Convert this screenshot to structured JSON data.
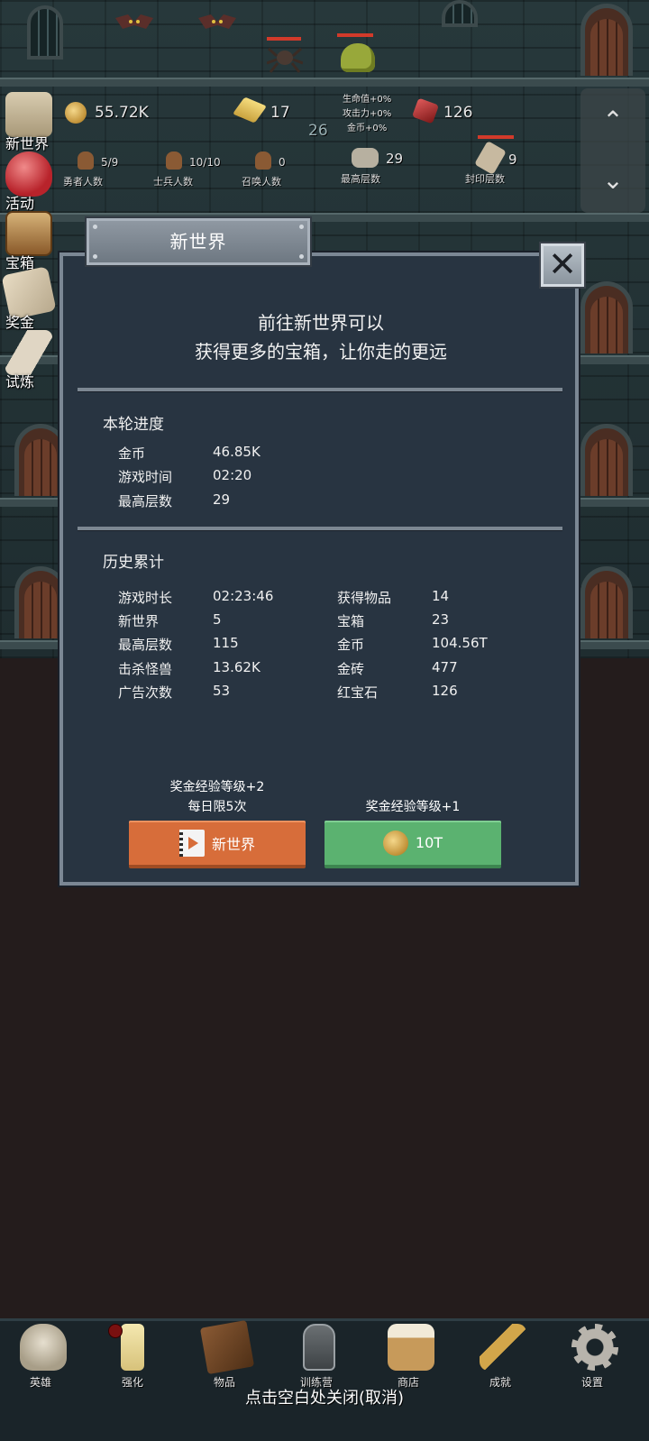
{
  "top": {
    "gold": "55.72K",
    "gold_bars": "17",
    "level_number": "26",
    "bonus_lines": [
      "生命值+0%",
      "攻击力+0%",
      "金币+0%"
    ],
    "rubies": "126",
    "heroes_value": "5/9",
    "heroes_label": "勇者人数",
    "soldiers_value": "10/10",
    "soldiers_label": "士兵人数",
    "summons_value": "0",
    "summons_label": "召唤人数",
    "max_floor_value": "29",
    "max_floor_label": "最高层数",
    "sealed_floor_value": "9",
    "sealed_floor_label": "封印层数"
  },
  "side_menu": [
    {
      "label": "新世界",
      "icon": "map-icon"
    },
    {
      "label": "活动",
      "icon": "heart-icon"
    },
    {
      "label": "宝箱",
      "icon": "chest-icon"
    },
    {
      "label": "奖金",
      "icon": "envelope-icon"
    },
    {
      "label": "试炼",
      "icon": "feather-icon"
    }
  ],
  "scroll": {
    "up": "⌃",
    "down": "⌄"
  },
  "dialog": {
    "title": "新世界",
    "close": "✕",
    "intro_line1": "前往新世界可以",
    "intro_line2": "获得更多的宝箱，让你走的更远",
    "current_title": "本轮进度",
    "current_rows": [
      {
        "label": "金币",
        "value": "46.85K"
      },
      {
        "label": "游戏时间",
        "value": "02:20"
      },
      {
        "label": "最高层数",
        "value": "29"
      }
    ],
    "history_title": "历史累计",
    "history_left": [
      {
        "label": "游戏时长",
        "value": "02:23:46"
      },
      {
        "label": "新世界",
        "value": "5"
      },
      {
        "label": "最高层数",
        "value": "115"
      },
      {
        "label": "击杀怪兽",
        "value": "13.62K"
      },
      {
        "label": "广告次数",
        "value": "53"
      }
    ],
    "history_right": [
      {
        "label": "获得物品",
        "value": "14"
      },
      {
        "label": "宝箱",
        "value": "23"
      },
      {
        "label": "金币",
        "value": "104.56T"
      },
      {
        "label": "金砖",
        "value": "477"
      },
      {
        "label": "红宝石",
        "value": "126"
      }
    ],
    "ad_caption_line1": "奖金经验等级+2",
    "ad_caption_line2": "每日限5次",
    "ad_button_label": "新世界",
    "coin_caption": "奖金经验等级+1",
    "coin_button_label": "10T"
  },
  "bottom_nav": [
    {
      "label": "英雄",
      "icon": "skull-icon"
    },
    {
      "label": "强化",
      "icon": "candle-icon"
    },
    {
      "label": "物品",
      "icon": "book-icon"
    },
    {
      "label": "训练营",
      "icon": "lantern-icon"
    },
    {
      "label": "商店",
      "icon": "mug-icon"
    },
    {
      "label": "成就",
      "icon": "key-icon"
    },
    {
      "label": "设置",
      "icon": "gear-icon"
    }
  ],
  "dismiss_text": "点击空白处关闭(取消)",
  "colors": {
    "dialog_bg": "#283441",
    "ad_button": "#d76d3a",
    "coin_button": "#5bb270"
  }
}
